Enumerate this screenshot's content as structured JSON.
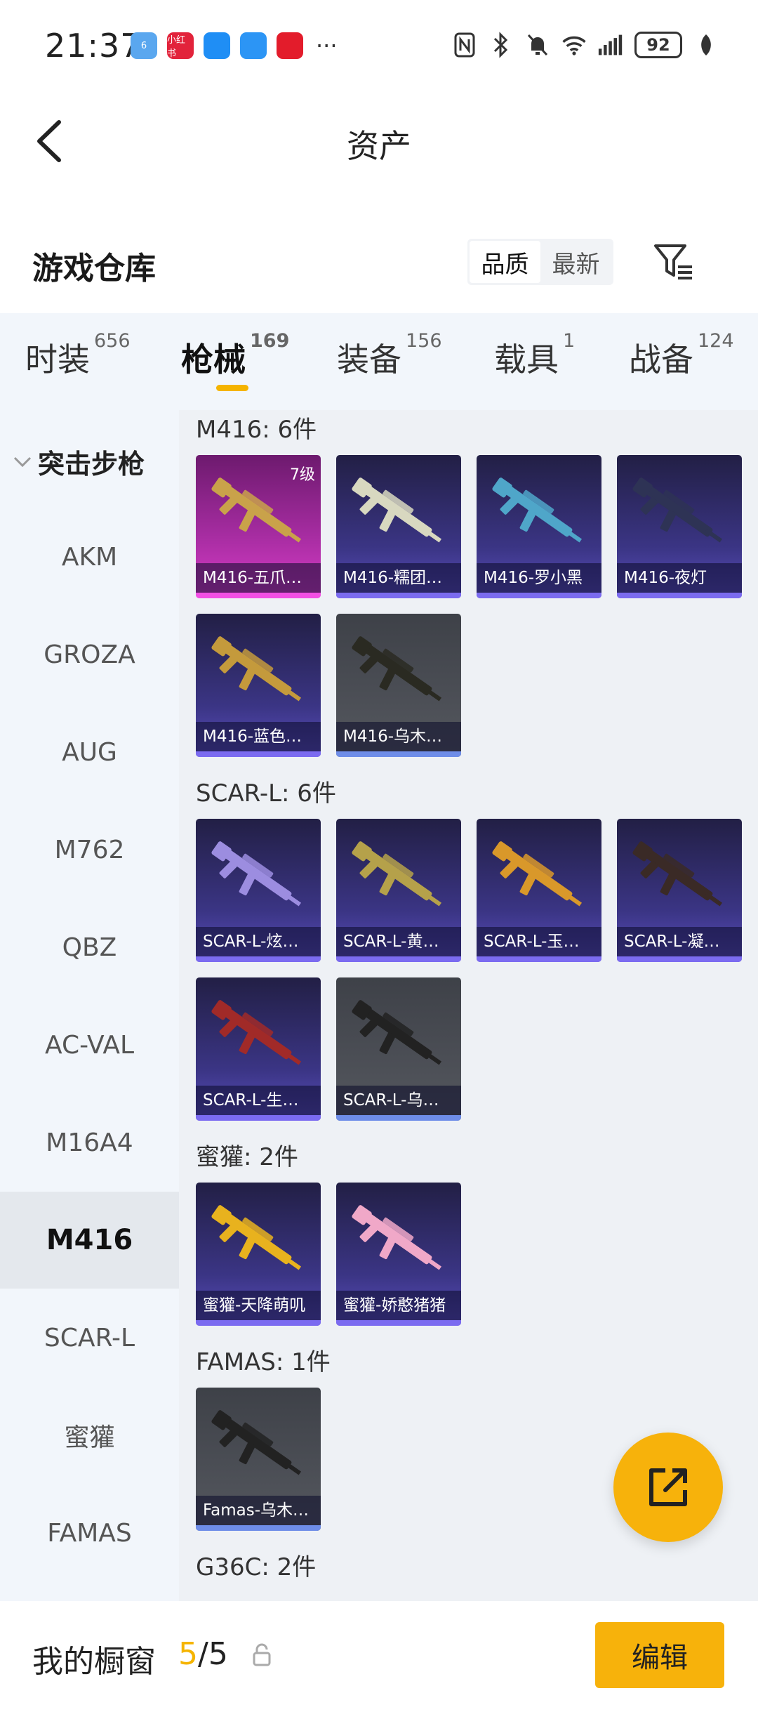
{
  "status_bar": {
    "time": "21:37",
    "notification_apps": [
      {
        "name": "app-icon-1",
        "color": "#5aa7ef",
        "text": "6"
      },
      {
        "name": "xiaohongshu-icon",
        "color": "#e2233b",
        "text": "小红书"
      },
      {
        "name": "message-icon",
        "color": "#1f8ef5",
        "text": ""
      },
      {
        "name": "app-icon-4",
        "color": "#2c95f5",
        "text": ""
      },
      {
        "name": "app-icon-5",
        "color": "#e31c2b",
        "text": ""
      }
    ],
    "more": "···",
    "battery": "92"
  },
  "header": {
    "title": "资产"
  },
  "warehouse": {
    "title": "游戏仓库",
    "sort_options": [
      "品质",
      "最新"
    ],
    "sort_active": "品质"
  },
  "tabs": [
    {
      "label": "时装",
      "count": "656"
    },
    {
      "label": "枪械",
      "count": "169",
      "active": true
    },
    {
      "label": "装备",
      "count": "156"
    },
    {
      "label": "载具",
      "count": "1"
    },
    {
      "label": "战备",
      "count": "124"
    }
  ],
  "sidebar": {
    "group": "突击步枪",
    "items": [
      "AKM",
      "GROZA",
      "AUG",
      "M762",
      "QBZ",
      "AC-VAL",
      "M16A4",
      "M416",
      "SCAR-L",
      "蜜獾",
      "FAMAS"
    ],
    "active": "M416"
  },
  "sections": [
    {
      "title": "M416: 6件",
      "items": [
        {
          "name": "M416-五爪…",
          "rarity": "gold",
          "level": "7级",
          "gun": "#c9a24a"
        },
        {
          "name": "M416-糯团…",
          "rarity": "purple",
          "gun": "#d8d8c0"
        },
        {
          "name": "M416-罗小黑",
          "rarity": "purple",
          "gun": "#4fa6c9"
        },
        {
          "name": "M416-夜灯",
          "rarity": "purple",
          "gun": "#2e3355"
        },
        {
          "name": "M416-蓝色…",
          "rarity": "purple",
          "gun": "#c49a3c"
        },
        {
          "name": "M416-乌木…",
          "rarity": "gray",
          "gun": "#2a2a22"
        }
      ]
    },
    {
      "title": "SCAR-L: 6件",
      "items": [
        {
          "name": "SCAR-L-炫…",
          "rarity": "purple",
          "gun": "#9c8de0"
        },
        {
          "name": "SCAR-L-黄…",
          "rarity": "purple",
          "gun": "#b5a14a"
        },
        {
          "name": "SCAR-L-玉…",
          "rarity": "purple",
          "gun": "#d9982a"
        },
        {
          "name": "SCAR-L-凝…",
          "rarity": "purple",
          "gun": "#3a2a26"
        },
        {
          "name": "SCAR-L-生…",
          "rarity": "purple",
          "gun": "#a12a28"
        },
        {
          "name": "SCAR-L-乌…",
          "rarity": "gray",
          "gun": "#222222"
        }
      ]
    },
    {
      "title": "蜜獾: 2件",
      "items": [
        {
          "name": "蜜獾-天降萌叽",
          "rarity": "purple",
          "gun": "#e8b21e"
        },
        {
          "name": "蜜獾-娇憨猪猪",
          "rarity": "purple",
          "gun": "#f0a8c8"
        }
      ]
    },
    {
      "title": "FAMAS: 1件",
      "items": [
        {
          "name": "Famas-乌木…",
          "rarity": "gray",
          "gun": "#222222"
        }
      ]
    },
    {
      "title": "G36C: 2件",
      "items": []
    }
  ],
  "bottom_bar": {
    "label": "我的橱窗",
    "current": "5",
    "separator": "/",
    "total": "5",
    "edit_label": "编辑"
  },
  "colors": {
    "accent": "#f7b20b",
    "tab_indicator": "#f5b400"
  }
}
